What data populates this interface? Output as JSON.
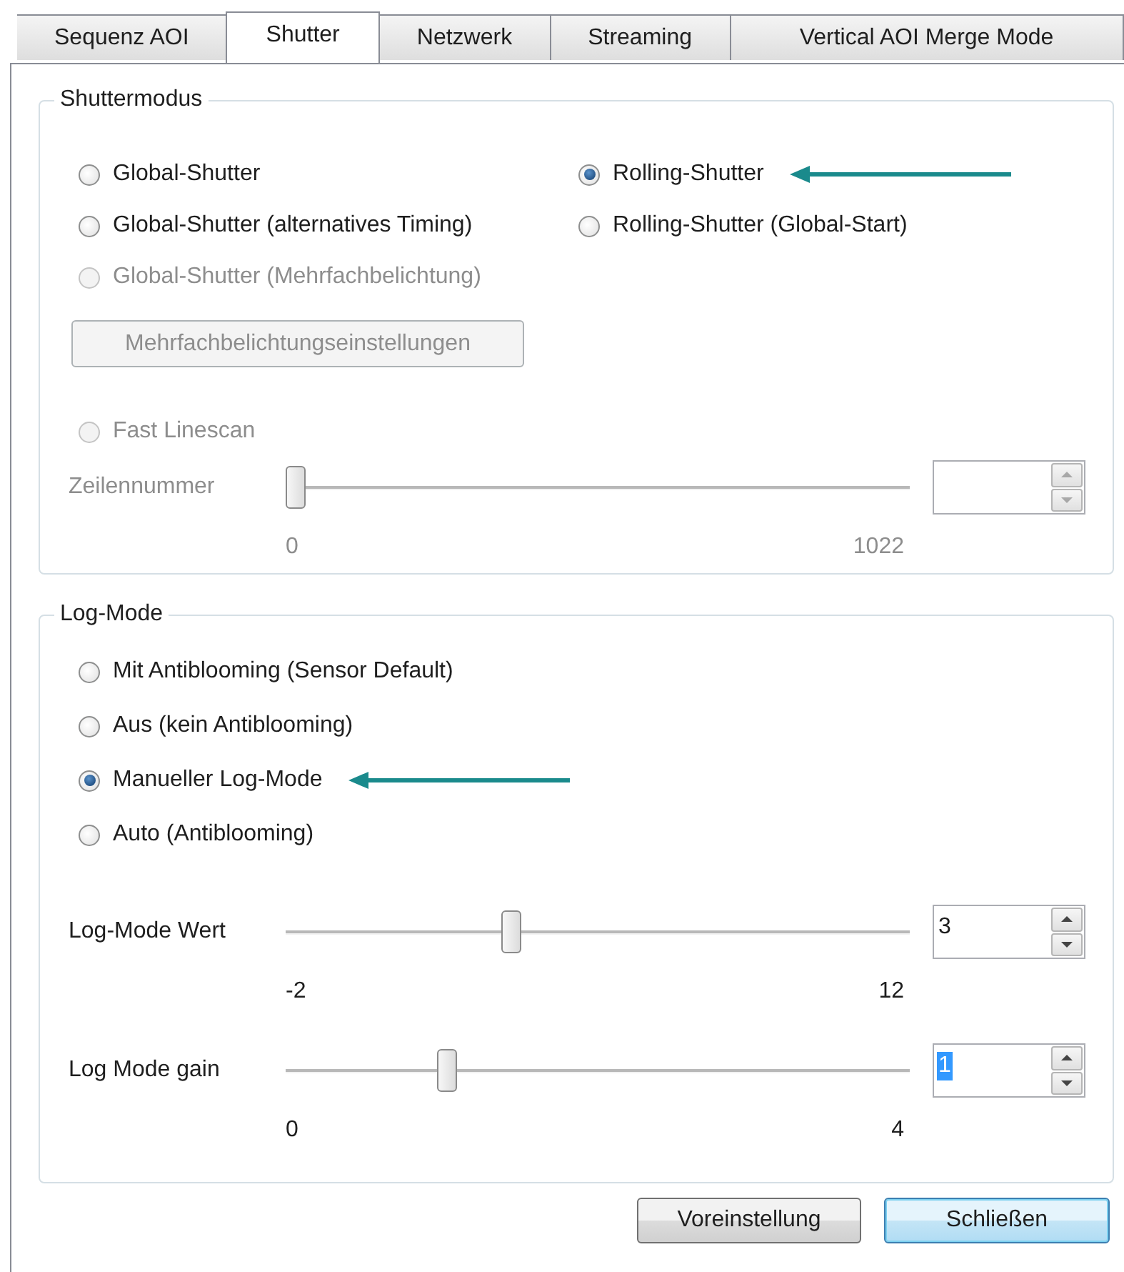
{
  "tabs": [
    {
      "label": "Sequenz AOI",
      "selected": false
    },
    {
      "label": "Shutter",
      "selected": true
    },
    {
      "label": "Netzwerk",
      "selected": false
    },
    {
      "label": "Streaming",
      "selected": false
    },
    {
      "label": "Vertical AOI Merge Mode",
      "selected": false
    }
  ],
  "shutter_mode": {
    "title": "Shuttermodus",
    "options": [
      {
        "label": "Global-Shutter",
        "selected": false,
        "disabled": false,
        "highlighted": false
      },
      {
        "label": "Rolling-Shutter",
        "selected": true,
        "disabled": false,
        "highlighted": true
      },
      {
        "label": "Global-Shutter (alternatives Timing)",
        "selected": false,
        "disabled": false,
        "highlighted": false
      },
      {
        "label": "Rolling-Shutter (Global-Start)",
        "selected": false,
        "disabled": false,
        "highlighted": false
      },
      {
        "label": "Global-Shutter (Mehrfachbelichtung)",
        "selected": false,
        "disabled": true,
        "highlighted": false
      }
    ],
    "settings_button": {
      "label": "Mehrfachbelichtungseinstellungen",
      "disabled": true
    },
    "fast_linescan": {
      "label": "Fast Linescan",
      "selected": false,
      "disabled": true,
      "highlighted": false
    },
    "line_slider": {
      "label": "Zeilennummer",
      "disabled": true,
      "level": 0,
      "min_label": "0",
      "max_label": "1022"
    }
  },
  "log_mode": {
    "title": "Log-Mode",
    "options": [
      {
        "label": "Mit Antiblooming (Sensor Default)",
        "selected": false,
        "disabled": false,
        "highlighted": false
      },
      {
        "label": "Aus (kein Antiblooming)",
        "selected": false,
        "disabled": false,
        "highlighted": false
      },
      {
        "label": "Manueller Log-Mode",
        "selected": true,
        "disabled": false,
        "highlighted": true
      },
      {
        "label": "Auto (Antiblooming)",
        "selected": false,
        "disabled": false,
        "highlighted": false
      }
    ],
    "sliders": [
      {
        "label": "Log-Mode Wert",
        "disabled": false,
        "level": 0.357,
        "min_label": "-2",
        "max_label": "12",
        "value": "3",
        "text_selected": false
      },
      {
        "label": "Log Mode gain",
        "disabled": false,
        "level": 0.25,
        "min_label": "0",
        "max_label": "4",
        "value": "1",
        "text_selected": true
      }
    ]
  },
  "buttons": [
    {
      "label": "Voreinstellung",
      "default": false
    },
    {
      "label": "Schließen",
      "default": true
    }
  ]
}
